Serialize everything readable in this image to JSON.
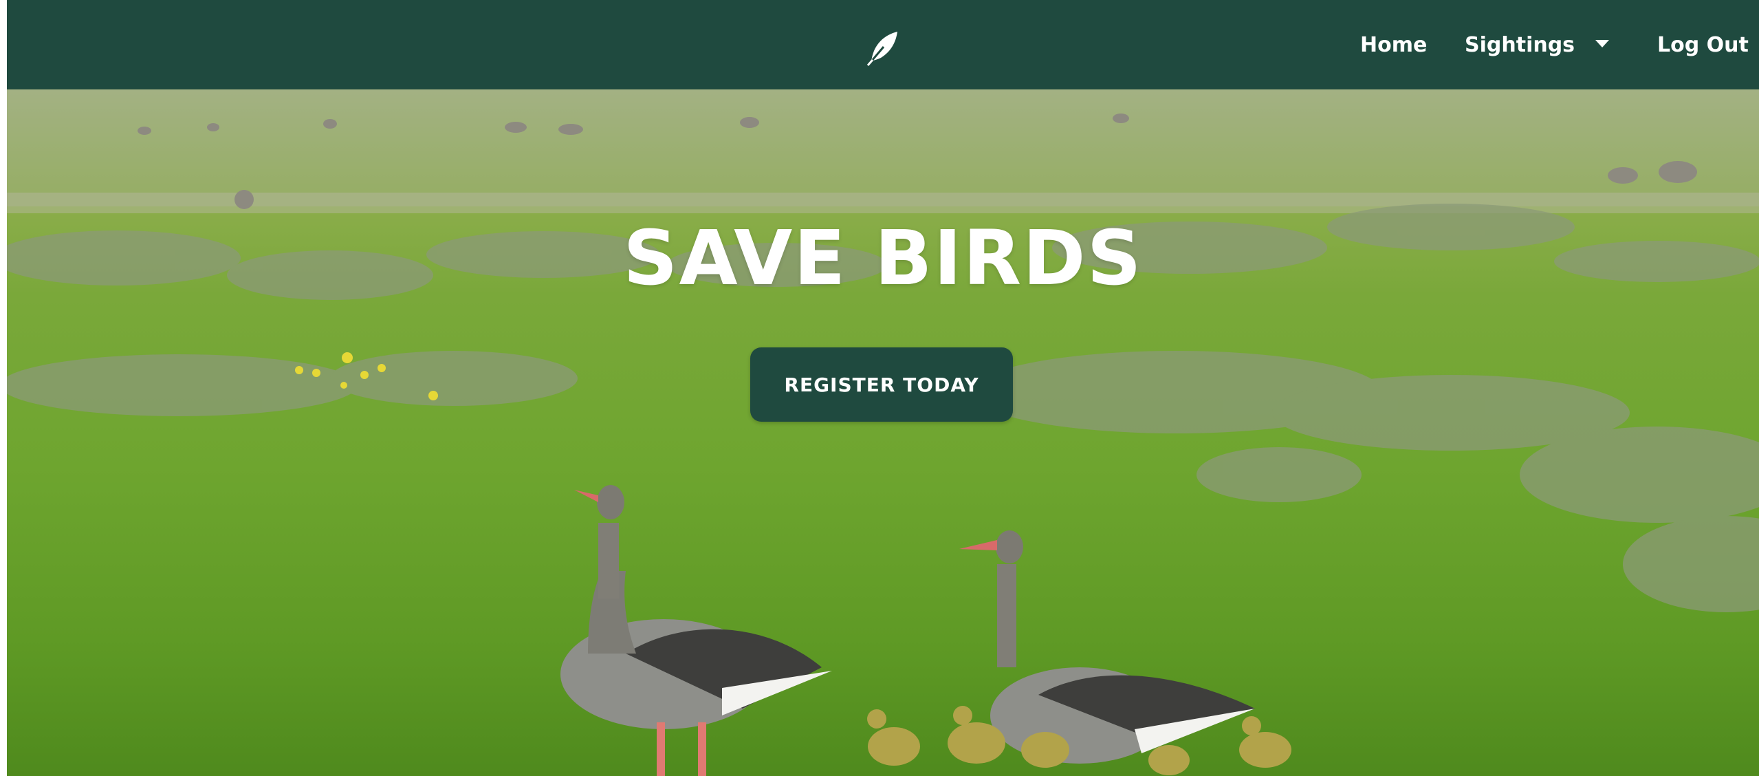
{
  "nav": {
    "logo_icon": "feather-icon",
    "home_label": "Home",
    "sightings_label": "Sightings",
    "sightings_caret_icon": "caret-down-icon",
    "logout_label": "Log Out"
  },
  "hero": {
    "title": "SAVE BIRDS",
    "cta_label": "REGISTER TODAY",
    "background_image": "geese-in-grass-field"
  },
  "colors": {
    "brand_dark_green": "#1f4a3f",
    "text_white": "#ffffff",
    "grass_green": "#6ea52f"
  }
}
